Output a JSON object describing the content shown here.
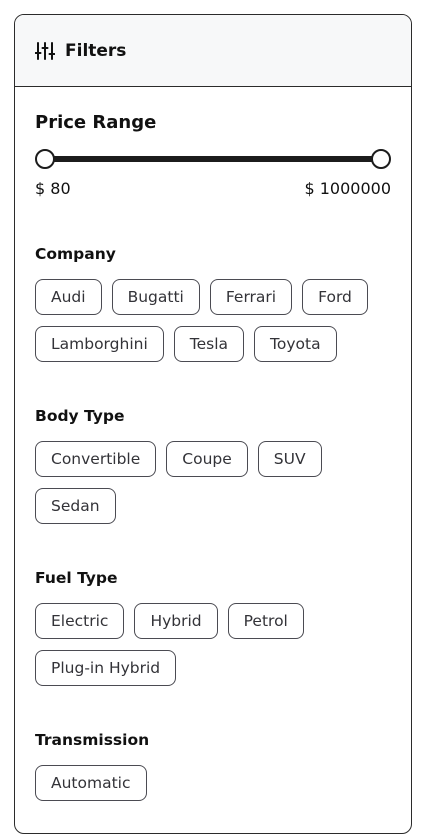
{
  "header": {
    "title": "Filters",
    "icon": "sliders-icon"
  },
  "price": {
    "title": "Price Range",
    "min_label": "$ 80",
    "max_label": "$ 1000000",
    "min_value": 80,
    "max_value": 1000000
  },
  "sections": [
    {
      "id": "company",
      "title": "Company",
      "options": [
        "Audi",
        "Bugatti",
        "Ferrari",
        "Ford",
        "Lamborghini",
        "Tesla",
        "Toyota"
      ]
    },
    {
      "id": "body-type",
      "title": "Body Type",
      "options": [
        "Convertible",
        "Coupe",
        "SUV",
        "Sedan"
      ]
    },
    {
      "id": "fuel-type",
      "title": "Fuel Type",
      "options": [
        "Electric",
        "Hybrid",
        "Petrol",
        "Plug-in Hybrid"
      ]
    },
    {
      "id": "transmission",
      "title": "Transmission",
      "options": [
        "Automatic"
      ]
    }
  ]
}
